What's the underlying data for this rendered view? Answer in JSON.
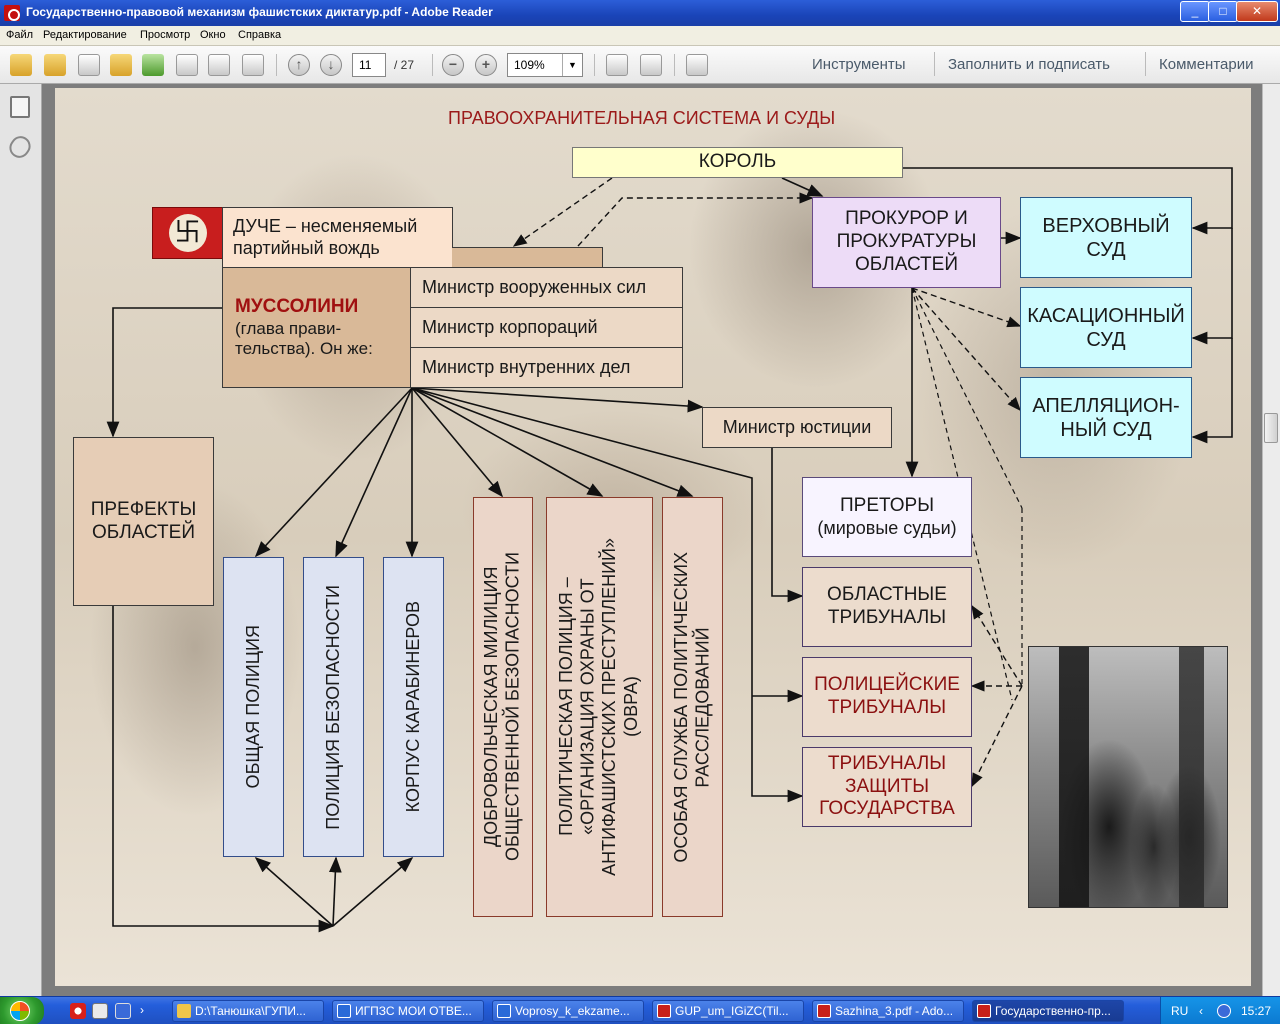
{
  "window": {
    "title": "Государственно-правовой механизм фашистских диктатур.pdf - Adobe Reader",
    "controls": {
      "minimize": "_",
      "maximize": "□",
      "close": "✕"
    }
  },
  "menu": [
    "Файл",
    "Редактирование",
    "Просмотр",
    "Окно",
    "Справка"
  ],
  "toolbar": {
    "page_current": "11",
    "page_total": "/ 27",
    "zoom": "109%",
    "zoom_out": "−",
    "zoom_in": "+",
    "links": [
      "Инструменты",
      "Заполнить и подписать",
      "Комментарии"
    ]
  },
  "document": {
    "heading": "ПРАВООХРАНИТЕЛЬНАЯ СИСТЕМА И СУДЫ",
    "king": "КОРОЛЬ",
    "duce": [
      "ДУЧЕ – несменяемый",
      "партийный вождь"
    ],
    "mussolini_name": "МУССОЛИНИ",
    "mussolini_desc": [
      "(глава прави-",
      "тельства). Он же:"
    ],
    "ministers": [
      "Министр вооруженных сил",
      "Министр корпораций",
      "Министр внутренних дел"
    ],
    "justice": "Министр юстиции",
    "prefects": [
      "ПРЕФЕКТЫ",
      "ОБЛАСТЕЙ"
    ],
    "police_columns": [
      "ОБЩАЯ ПОЛИЦИЯ",
      "ПОЛИЦИЯ БЕЗОПАСНОСТИ",
      "КОРПУС КАРАБИНЕРОВ"
    ],
    "militia": [
      "ДОБРОВОЛЬЧЕСКАЯ МИЛИЦИЯ",
      "ОБЩЕСТВЕННОЙ БЕЗОПАСНОСТИ"
    ],
    "ovra": [
      "ПОЛИТИЧЕСКАЯ ПОЛИЦИЯ –",
      "«ОРГАНИЗАЦИЯ ОХРАНЫ ОТ",
      "АНТИФАШИСТСКИХ ПРЕСТУПЛЕНИЙ»",
      "(ОВРА)"
    ],
    "special_service": [
      "ОСОБАЯ СЛУЖБА ПОЛИТИЧЕСКИХ",
      "РАССЛЕДОВАНИЙ"
    ],
    "prosecutor": [
      "ПРОКУРОР И",
      "ПРОКУРАТУРЫ",
      "ОБЛАСТЕЙ"
    ],
    "supreme_court": [
      "ВЕРХОВНЫЙ",
      "СУД"
    ],
    "cassation": [
      "КАСАЦИОННЫЙ",
      "СУД"
    ],
    "appeal": [
      "АПЕЛЛЯЦИОН-",
      "НЫЙ СУД"
    ],
    "praetors": [
      "ПРЕТОРЫ",
      "(мировые судьи)"
    ],
    "regional_tribunals": [
      "ОБЛАСТНЫЕ",
      "ТРИБУНАЛЫ"
    ],
    "police_tribunals": [
      "ПОЛИЦЕЙСКИЕ",
      "ТРИБУНАЛЫ"
    ],
    "state_tribunals": [
      "ТРИБУНАЛЫ",
      "ЗАЩИТЫ",
      "ГОСУДАРСТВА"
    ]
  },
  "taskbar": {
    "items": [
      {
        "label": "D:\\Танюшка\\ГУПИ...",
        "icon": "folder"
      },
      {
        "label": "ИГПЗС МОИ ОТВЕ...",
        "icon": "doc"
      },
      {
        "label": "Voprosy_k_ekzame...",
        "icon": "doc"
      },
      {
        "label": "GUP_um_IGiZC(Til...",
        "icon": "pdf"
      },
      {
        "label": "Sazhina_3.pdf - Ado...",
        "icon": "pdf"
      },
      {
        "label": "Государственно-пр...",
        "icon": "pdf"
      }
    ],
    "lang": "RU",
    "time": "15:27"
  }
}
